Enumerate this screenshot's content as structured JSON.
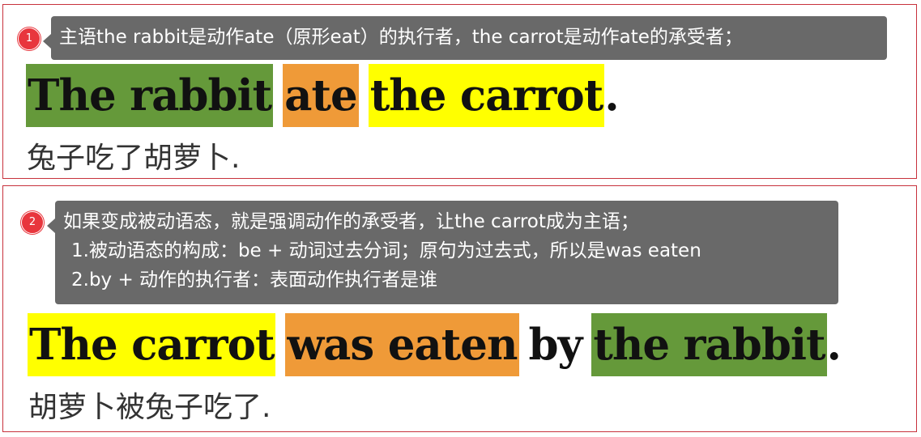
{
  "panel1": {
    "badge": "1",
    "note": "主语the rabbit是动作ate（原形eat）的执行者，the carrot是动作ate的承受者；",
    "sentence": {
      "subject": "The rabbit",
      "verb": "ate",
      "object": "the carrot",
      "end": "."
    },
    "translation": "兔子吃了胡萝卜."
  },
  "panel2": {
    "badge": "2",
    "note_lines": [
      "如果变成被动语态，就是强调动作的承受者，让the carrot成为主语；",
      "1.被动语态的构成：be + 动词过去分词；原句为过去式，所以是was eaten",
      "2.by + 动作的执行者：表面动作执行者是谁"
    ],
    "sentence": {
      "subject": "The carrot",
      "verb": "was eaten",
      "by": "by",
      "agent": "the rabbit",
      "end": "."
    },
    "translation": "胡萝卜被兔子吃了."
  },
  "colors": {
    "green_highlight": "#65993a",
    "orange_highlight": "#ef9a38",
    "yellow_highlight": "#ffff00",
    "callout_bg": "#696969",
    "badge": "#e8363d",
    "panel_border": "#c8323c"
  }
}
